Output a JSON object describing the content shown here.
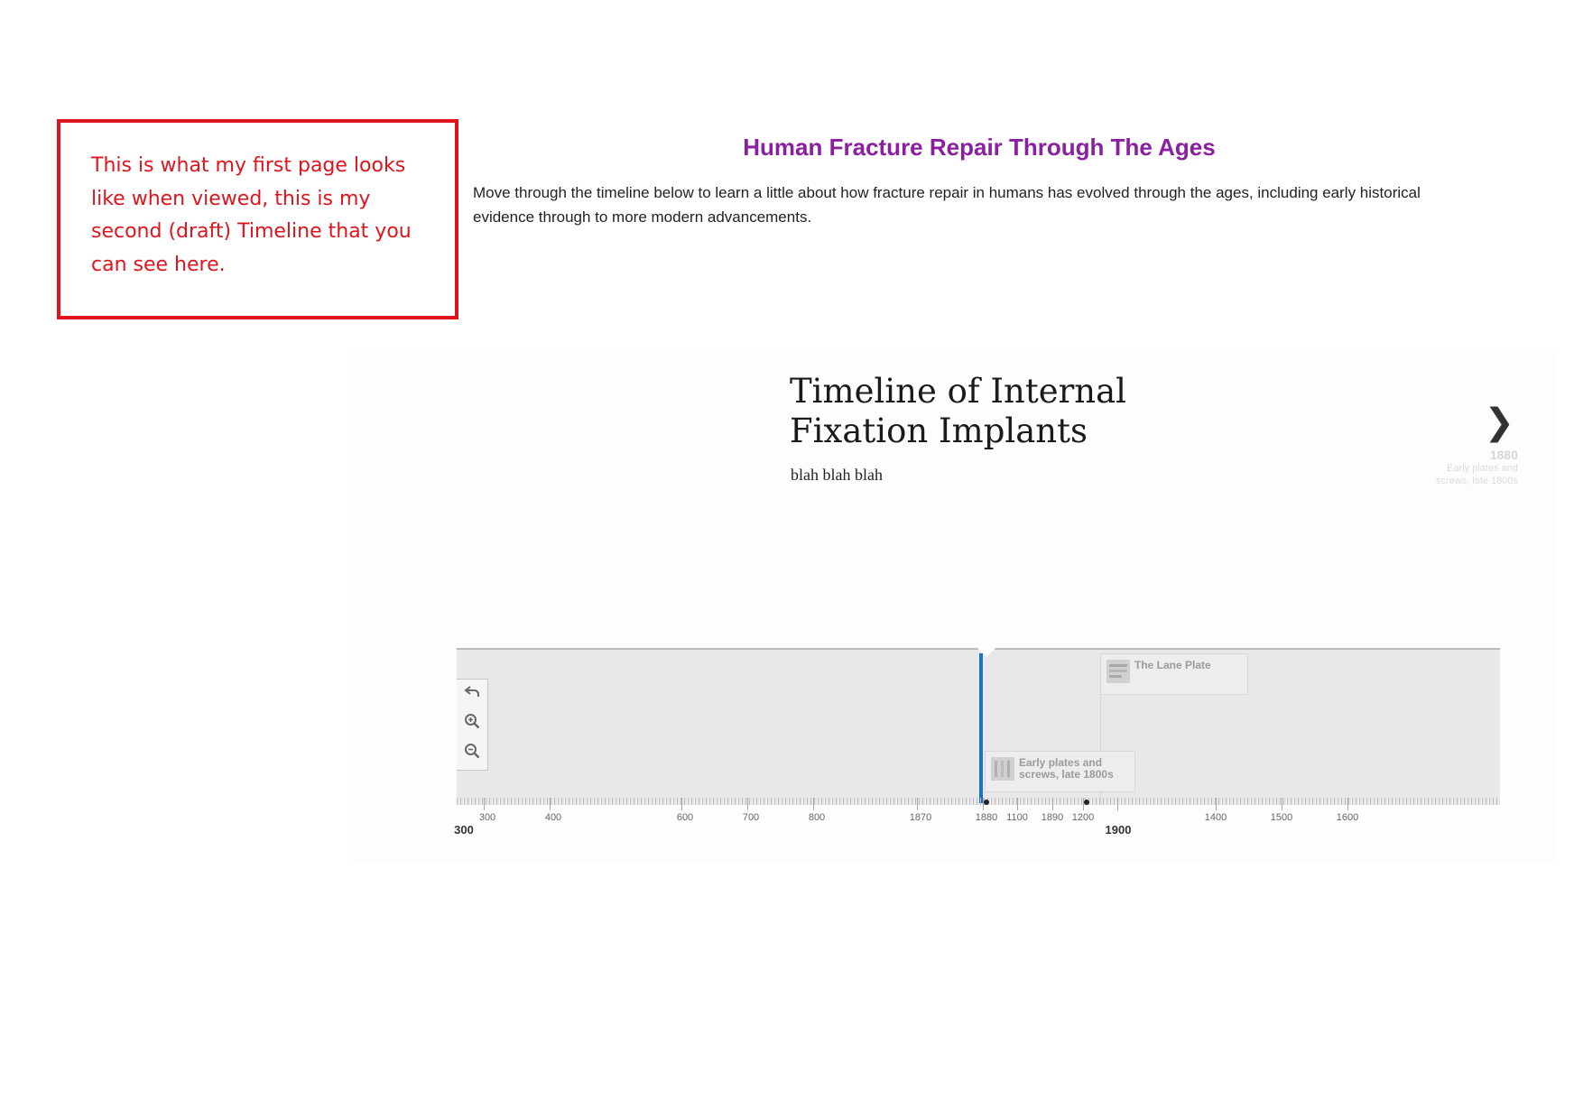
{
  "note": {
    "text": "This is what my first page looks like when viewed, this is my second (draft) Timeline that you can see here."
  },
  "page": {
    "title": "Human Fracture Repair Through The Ages",
    "intro": "Move through the timeline below to learn a little about how fracture repair in humans has evolved through the ages, including early historical evidence through to more modern advancements."
  },
  "slide": {
    "title": "Timeline of Internal Fixation Implants",
    "text": "blah blah blah"
  },
  "next": {
    "icon": "chevron-right-icon",
    "date": "1880",
    "title": "Early plates and screws, late 1800s"
  },
  "navigator": {
    "zoom_icons": [
      "back-arrow-icon",
      "zoom-in-icon",
      "zoom-out-icon"
    ],
    "flags": [
      {
        "label": "The Lane Plate"
      },
      {
        "label": "Early plates and screws, late 1800s"
      }
    ],
    "ticks": [
      "300",
      "400",
      "600",
      "700",
      "800",
      "1870",
      "1880",
      "1100",
      "1890",
      "1200",
      "1400",
      "1500",
      "1600"
    ],
    "major_ticks": [
      "300",
      "1900"
    ]
  },
  "colors": {
    "note_border": "#e0141c",
    "title": "#8a1fa0",
    "marker": "#1a73c8"
  }
}
